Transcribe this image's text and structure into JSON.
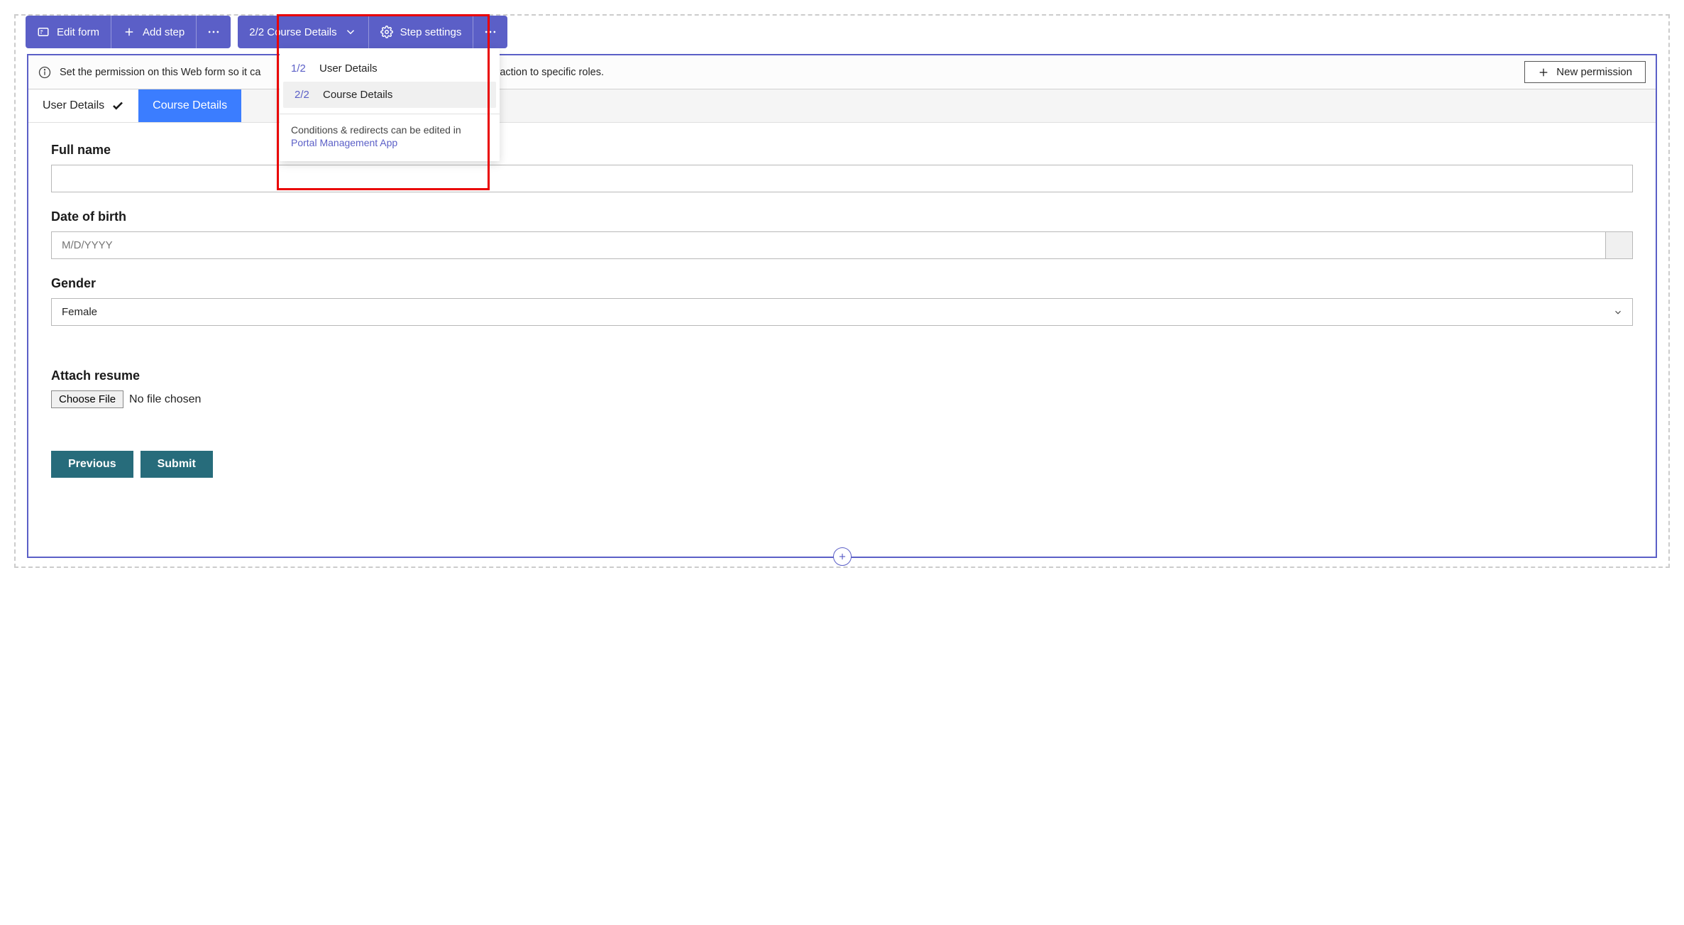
{
  "toolbar1": {
    "edit_form": "Edit form",
    "add_step": "Add step"
  },
  "toolbar2": {
    "step_label": "2/2 Course Details",
    "step_settings": "Step settings"
  },
  "dropdown": {
    "items": [
      {
        "num": "1/2",
        "name": "User Details"
      },
      {
        "num": "2/2",
        "name": "Course Details"
      }
    ],
    "footer_text": "Conditions & redirects can be edited in",
    "footer_link": "Portal Management App"
  },
  "info_bar": {
    "message_left": "Set the permission on this Web form so it ca",
    "message_right": "r limit the interaction to specific roles.",
    "new_permission": "New permission"
  },
  "tabs": {
    "completed": "User Details",
    "active": "Course Details"
  },
  "fields": {
    "full_name_label": "Full name",
    "dob_label": "Date of birth",
    "dob_placeholder": "M/D/YYYY",
    "gender_label": "Gender",
    "gender_value": "Female",
    "resume_label": "Attach resume",
    "choose_file": "Choose File",
    "no_file": "No file chosen"
  },
  "buttons": {
    "previous": "Previous",
    "submit": "Submit"
  }
}
